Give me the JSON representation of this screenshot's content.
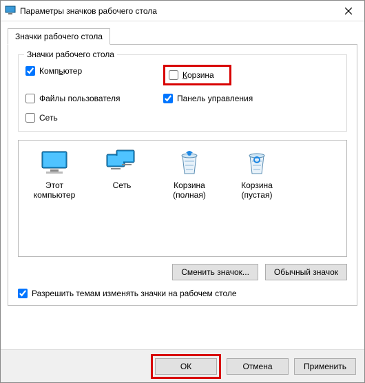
{
  "window": {
    "title": "Параметры значков рабочего стола"
  },
  "tab": {
    "label": "Значки рабочего стола"
  },
  "group": {
    "legend": "Значки рабочего стола",
    "items": [
      {
        "label": "Компьютер",
        "u": 4,
        "checked": true
      },
      {
        "label": "Корзина",
        "u": 0,
        "checked": false,
        "highlight": true
      },
      {
        "label": "Файлы пользователя",
        "u": -1,
        "checked": false
      },
      {
        "label": "Панель управления",
        "u": -1,
        "checked": true
      },
      {
        "label": "Сеть",
        "u": -1,
        "checked": false
      }
    ]
  },
  "icons": [
    {
      "label": "Этот компьютер",
      "type": "monitor"
    },
    {
      "label": "Сеть",
      "type": "monitors"
    },
    {
      "label": "Корзина (полная)",
      "type": "bin-full"
    },
    {
      "label": "Корзина (пустая)",
      "type": "bin-empty"
    }
  ],
  "buttons": {
    "change": "Сменить значок...",
    "default": "Обычный значок"
  },
  "allow": {
    "label": "Разрешить темам изменять значки на рабочем столе",
    "checked": true
  },
  "footer": {
    "ok": "ОК",
    "cancel": "Отмена",
    "apply": "Применить"
  }
}
